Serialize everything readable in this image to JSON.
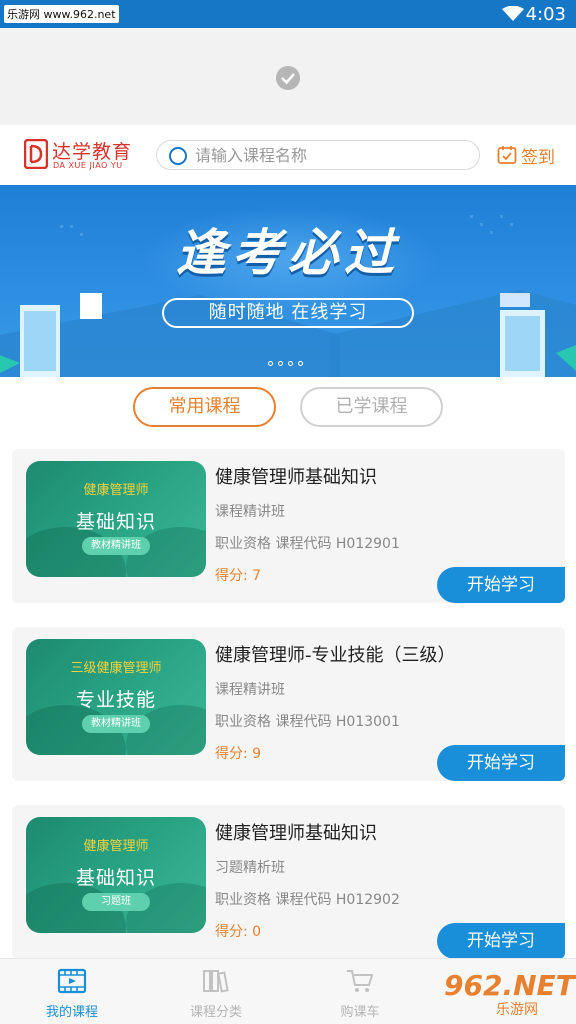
{
  "status_bar": {
    "watermark": "乐游网 www.962.net",
    "time": "4:03"
  },
  "header": {
    "brand_title": "达学教育",
    "brand_sub": "DA XUE JIAO YU",
    "search_placeholder": "请输入课程名称",
    "signin_label": "签到"
  },
  "banner": {
    "headline": "逢考必过",
    "tagline": "随时随地   在线学习"
  },
  "tabs": [
    {
      "label": "常用课程",
      "active": true
    },
    {
      "label": "已学课程",
      "active": false
    }
  ],
  "courses": [
    {
      "thumb_tag": "健康管理师",
      "thumb_title": "基础知识",
      "thumb_badge": "教材精讲班",
      "title": "健康管理师基础知识",
      "class_type": "课程精讲班",
      "meta": "职业资格  课程代码 H012901",
      "score": "得分: 7",
      "button": "开始学习"
    },
    {
      "thumb_tag": "三级健康管理师",
      "thumb_title": "专业技能",
      "thumb_badge": "教材精讲班",
      "title": "健康管理师-专业技能（三级）",
      "class_type": "课程精讲班",
      "meta": "职业资格  课程代码 H013001",
      "score": "得分: 9",
      "button": "开始学习"
    },
    {
      "thumb_tag": "健康管理师",
      "thumb_title": "基础知识",
      "thumb_badge": "习题班",
      "title": "健康管理师基础知识",
      "class_type": "习题精析班",
      "meta": "职业资格  课程代码 H012902",
      "score": "得分: 0",
      "button": "开始学习"
    }
  ],
  "bottom_nav": [
    {
      "label": "我的课程",
      "icon": "video-icon",
      "active": true
    },
    {
      "label": "课程分类",
      "icon": "books-icon",
      "active": false
    },
    {
      "label": "购课车",
      "icon": "cart-icon",
      "active": false
    }
  ],
  "corner_watermark": {
    "main": "962.NET",
    "sub": "乐游网"
  },
  "colors": {
    "primary": "#1a8fd9",
    "accent": "#e8812f",
    "brand_red": "#d8332b",
    "thumb_green": "#2aa685"
  }
}
